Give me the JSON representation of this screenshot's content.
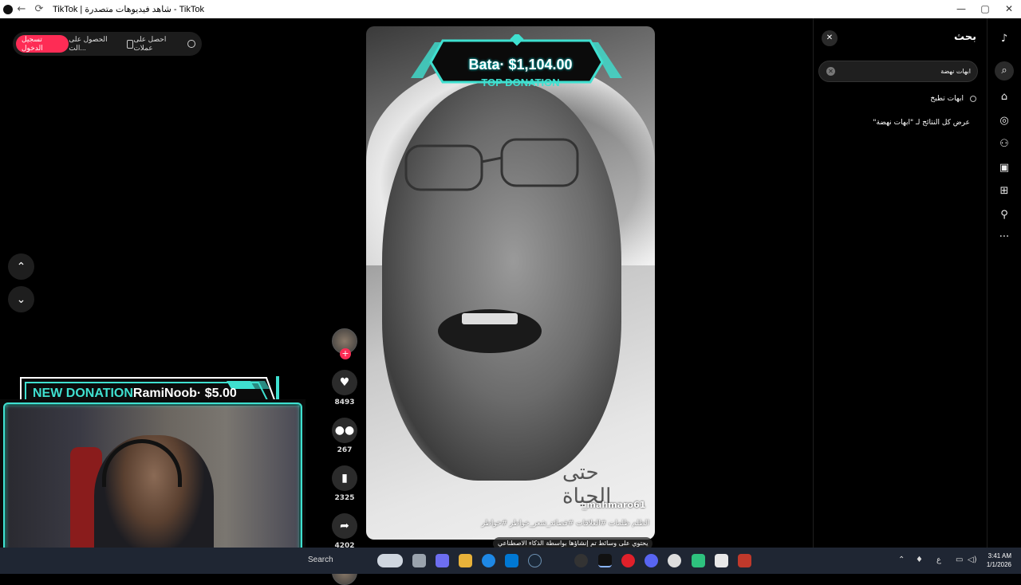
{
  "window": {
    "title": "TikTok | شاهد فيديوهات متصدرة - TikTok",
    "controls": {
      "minimize": "—",
      "maximize": "▢",
      "close": "✕"
    }
  },
  "top_pill": {
    "login_label": "تسجيل الدخول",
    "get_app_label": "الحصول على الت...",
    "coins_label": "احصل على عملات"
  },
  "video": {
    "author": "_mahmaro61",
    "caption": "الظلم ظلمات #العلاقات #قصائد_شعر_خواطر #خواطر",
    "ai_badge": "يحتوي على وسائط تم إنشاؤها بواسطة الذكاء الاصطناعي",
    "overlay_banner": "Bata· $1,104.00",
    "overlay_sub": "TOP DONATION",
    "watermark": "حتى الحياة"
  },
  "actions": {
    "likes": "8493",
    "comments": "267",
    "saves": "2325",
    "shares": "4202"
  },
  "search_panel": {
    "title": "بحث",
    "query": "ابهات نهضة",
    "suggestion": "ابهات تطبخ",
    "view_all": "عرض كل النتائج لـ \"ابهات نهضة\""
  },
  "donation": {
    "label": "NEW DONATION",
    "value": "RamiNoob· $5.00"
  },
  "taskbar": {
    "search_label": "Search",
    "time": "3:41 AM",
    "date": "1/1/2026",
    "lang": "ع"
  },
  "colors": {
    "accent": "#fe2c55",
    "overlay_teal": "#3fe0d0",
    "taskbar": "#1f2633"
  }
}
